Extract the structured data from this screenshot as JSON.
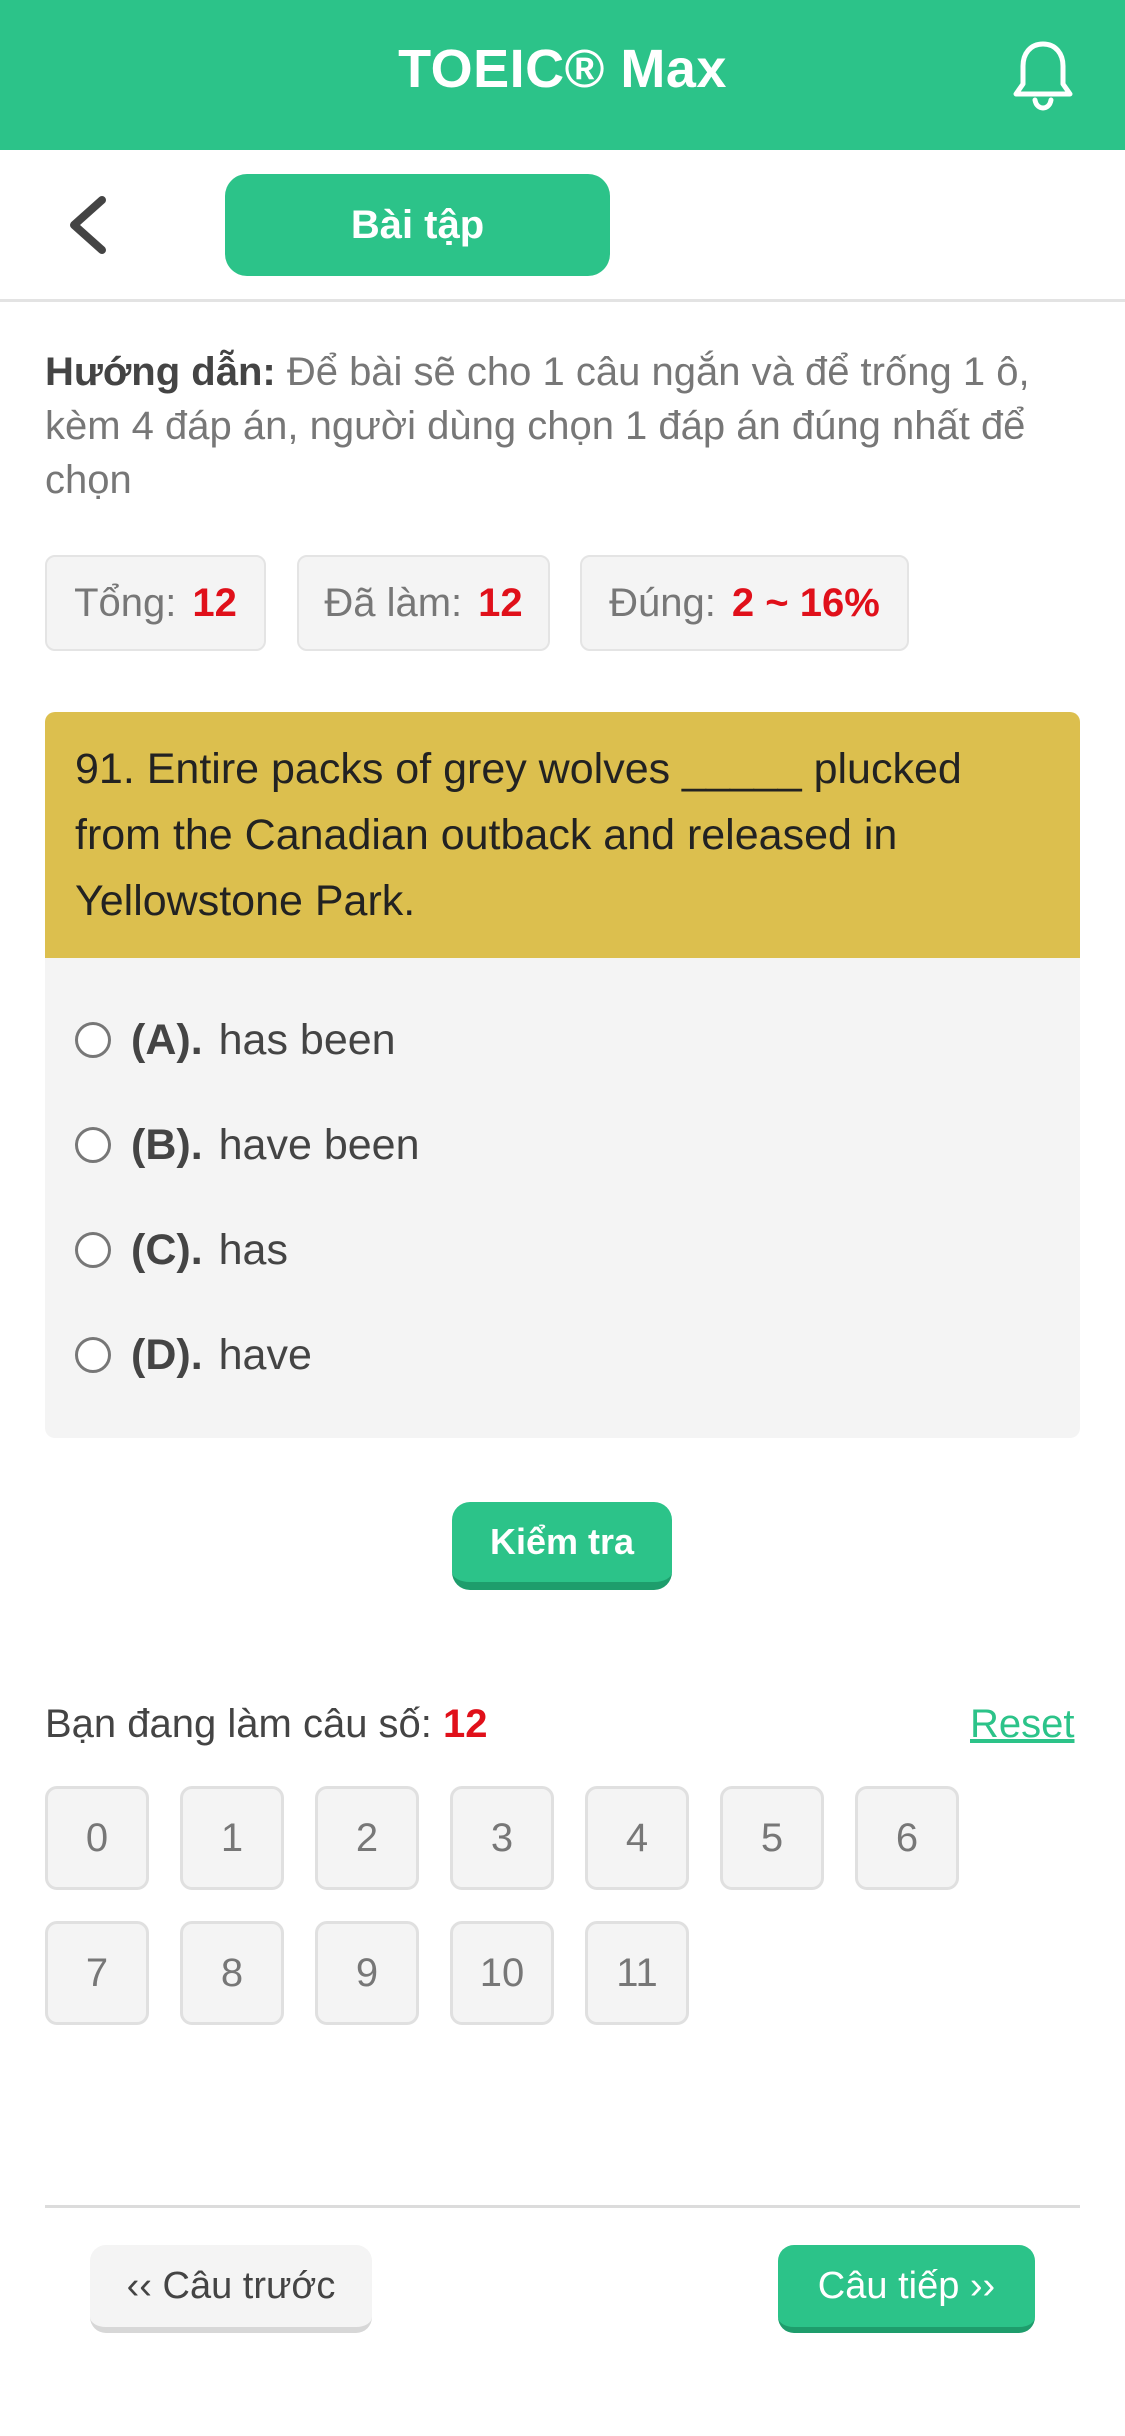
{
  "header": {
    "title": "TOEIC® Max"
  },
  "nav": {
    "tab_label": "Bài tập"
  },
  "instructions": {
    "label": "Hướng dẫn:",
    "text": " Để bài sẽ cho 1 câu ngắn và để trống 1 ô, kèm 4 đáp án, người dùng chọn 1 đáp án đúng nhất để chọn"
  },
  "stats": {
    "total_label": "Tổng:",
    "total_value": "12",
    "done_label": "Đã làm:",
    "done_value": "12",
    "correct_label": "Đúng:",
    "correct_value": "2 ~ 16%"
  },
  "question": {
    "text": "91. Entire packs of grey wolves _____ plucked from the Canadian outback and released in Yellowstone Park.",
    "options": [
      {
        "label": "(A).",
        "text": "has been"
      },
      {
        "label": "(B).",
        "text": "have been"
      },
      {
        "label": "(C).",
        "text": "has"
      },
      {
        "label": "(D).",
        "text": "have"
      }
    ]
  },
  "check_button": "Kiểm tra",
  "progress": {
    "label": "Bạn đang làm câu số:",
    "current": "12",
    "reset_label": "Reset"
  },
  "question_numbers": [
    "0",
    "1",
    "2",
    "3",
    "4",
    "5",
    "6",
    "7",
    "8",
    "9",
    "10",
    "11"
  ],
  "footer": {
    "prev_label": "‹‹ Câu trước",
    "next_label": "Câu tiếp ››"
  },
  "colors": {
    "accent": "#2cc389",
    "question_bg": "#dcbf4e",
    "highlight_red": "#e0101a"
  },
  "icons": {
    "notification": "bell-icon",
    "back": "chevron-left-icon"
  }
}
